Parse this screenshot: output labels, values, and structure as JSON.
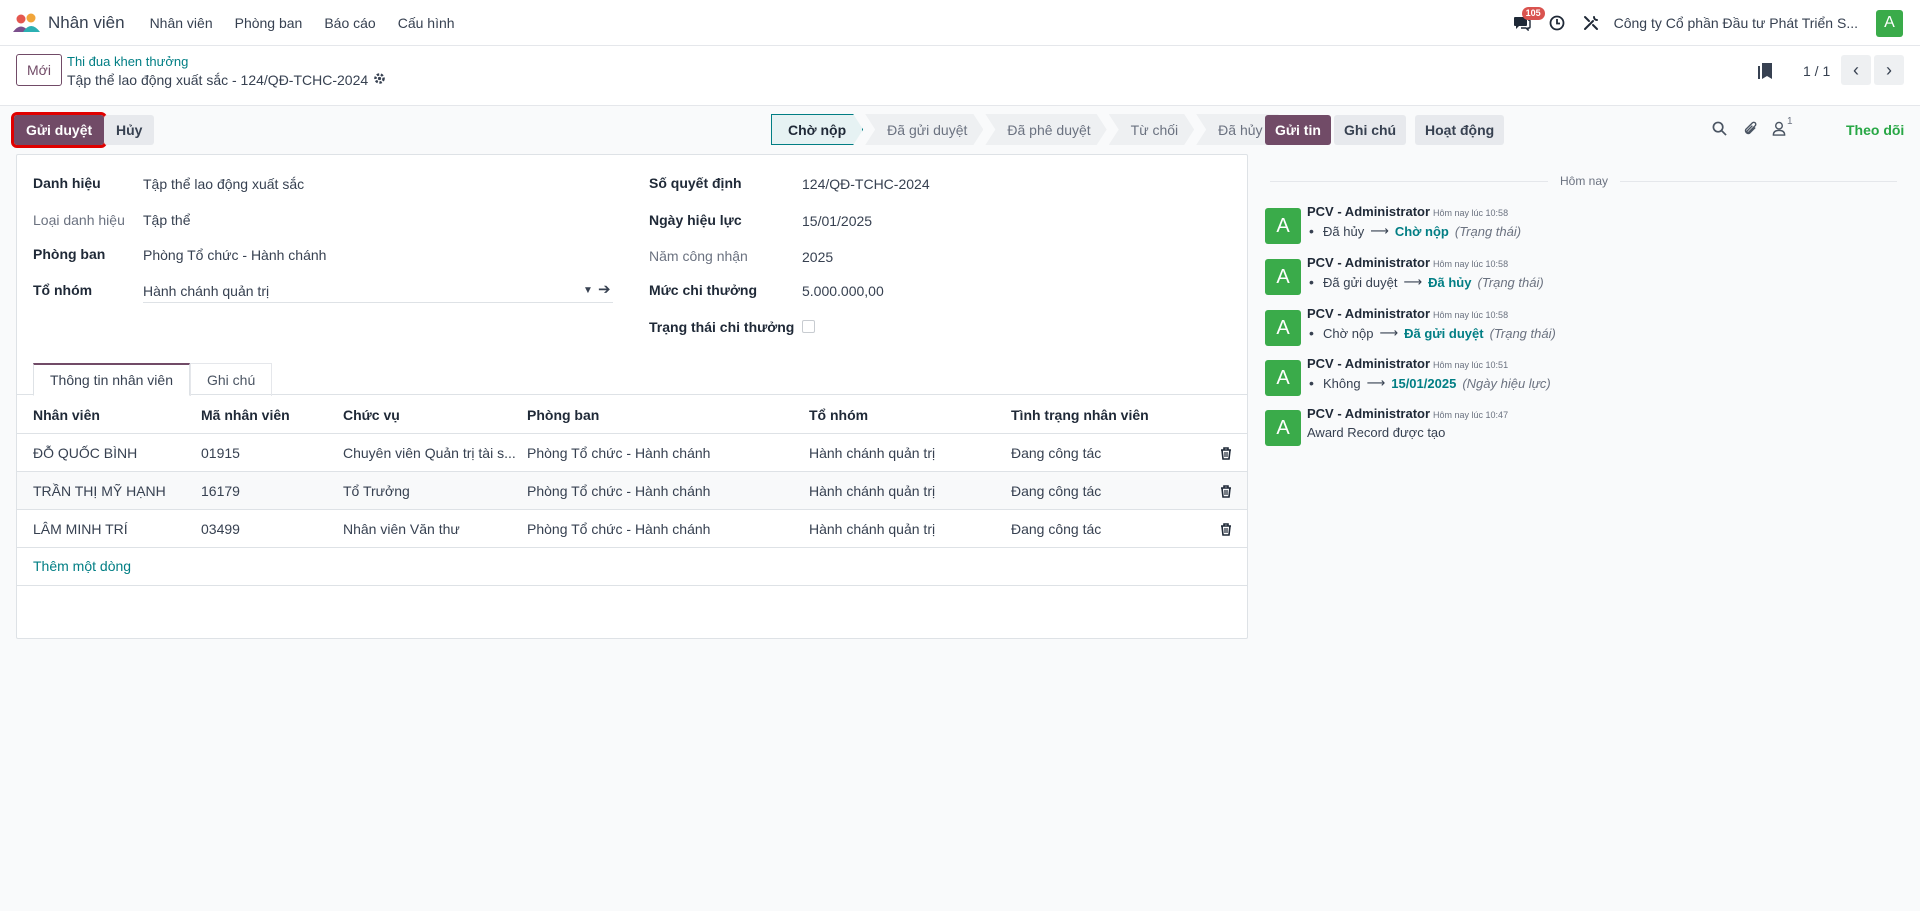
{
  "navbar": {
    "app_name": "Nhân viên",
    "menus": [
      "Nhân viên",
      "Phòng ban",
      "Báo cáo",
      "Cấu hình"
    ],
    "message_count": "105",
    "company": "Công ty Cổ phần Đầu tư Phát Triển S...",
    "user_initial": "A"
  },
  "control": {
    "new_label": "Mới",
    "breadcrumb_parent": "Thi đua khen thưởng",
    "breadcrumb_current": "Tập thể lao động xuất sắc - 124/QĐ-TCHC-2024",
    "pager": "1 / 1"
  },
  "actions": {
    "submit_label": "Gửi duyệt",
    "cancel_label": "Hủy"
  },
  "statusbar": [
    "Chờ nộp",
    "Đã gửi duyệt",
    "Đã phê duyệt",
    "Từ chối",
    "Đã hủy"
  ],
  "status_active": "Chờ nộp",
  "form": {
    "danh_hieu_label": "Danh hiệu",
    "danh_hieu": "Tập thể lao động xuất sắc",
    "loai_label": "Loại danh hiệu",
    "loai": "Tập thể",
    "phong_ban_label": "Phòng ban",
    "phong_ban": "Phòng Tổ chức - Hành chánh",
    "to_nhom_label": "Tổ nhóm",
    "to_nhom": "Hành chánh quản trị",
    "so_qd_label": "Số quyết định",
    "so_qd": "124/QĐ-TCHC-2024",
    "ngay_label": "Ngày hiệu lực",
    "ngay": "15/01/2025",
    "nam_label": "Năm công nhận",
    "nam": "2025",
    "muc_label": "Mức chi thưởng",
    "muc": "5.000.000,00",
    "trang_thai_label": "Trạng thái chi thưởng",
    "trang_thai_checked": false
  },
  "tabs": [
    "Thông tin nhân viên",
    "Ghi chú"
  ],
  "table": {
    "columns": [
      "Nhân viên",
      "Mã nhân viên",
      "Chức vụ",
      "Phòng ban",
      "Tổ nhóm",
      "Tình trạng nhân viên"
    ],
    "rows": [
      [
        "ĐỖ QUỐC BÌNH",
        "01915",
        "Chuyên viên Quản trị tài s...",
        "Phòng Tổ chức - Hành chánh",
        "Hành chánh quản trị",
        "Đang công tác"
      ],
      [
        "TRẦN THỊ MỸ HẠNH",
        "16179",
        "Tổ Trưởng",
        "Phòng Tổ chức - Hành chánh",
        "Hành chánh quản trị",
        "Đang công tác"
      ],
      [
        "LÂM MINH TRÍ",
        "03499",
        "Nhân viên Văn thư",
        "Phòng Tổ chức - Hành chánh",
        "Hành chánh quản trị",
        "Đang công tác"
      ]
    ],
    "add_line": "Thêm một dòng"
  },
  "chatter": {
    "send_label": "Gửi tin",
    "note_label": "Ghi chú",
    "activity_label": "Hoạt động",
    "follower_count": "1",
    "follow_label": "Theo dõi",
    "today_label": "Hôm nay",
    "messages": [
      {
        "author": "PCV - Administrator",
        "time": "Hôm nay lúc 10:58",
        "old": "Đã hủy",
        "new": "Chờ nộp",
        "field": "(Trạng thái)"
      },
      {
        "author": "PCV - Administrator",
        "time": "Hôm nay lúc 10:58",
        "old": "Đã gửi duyệt",
        "new": "Đã hủy",
        "field": "(Trạng thái)"
      },
      {
        "author": "PCV - Administrator",
        "time": "Hôm nay lúc 10:58",
        "old": "Chờ nộp",
        "new": "Đã gửi duyệt",
        "field": "(Trạng thái)"
      },
      {
        "author": "PCV - Administrator",
        "time": "Hôm nay lúc 10:51",
        "old": "Không",
        "new": "15/01/2025",
        "field": "(Ngày hiệu lực)"
      },
      {
        "author": "PCV - Administrator",
        "time": "Hôm nay lúc 10:47",
        "body": "Award Record được tạo"
      }
    ],
    "avatar_initial": "A"
  },
  "colors": {
    "brand": "#714b67",
    "link": "#017e84",
    "avatar": "#3aab4a",
    "follow": "#28a745",
    "badge": "#d9534f"
  }
}
